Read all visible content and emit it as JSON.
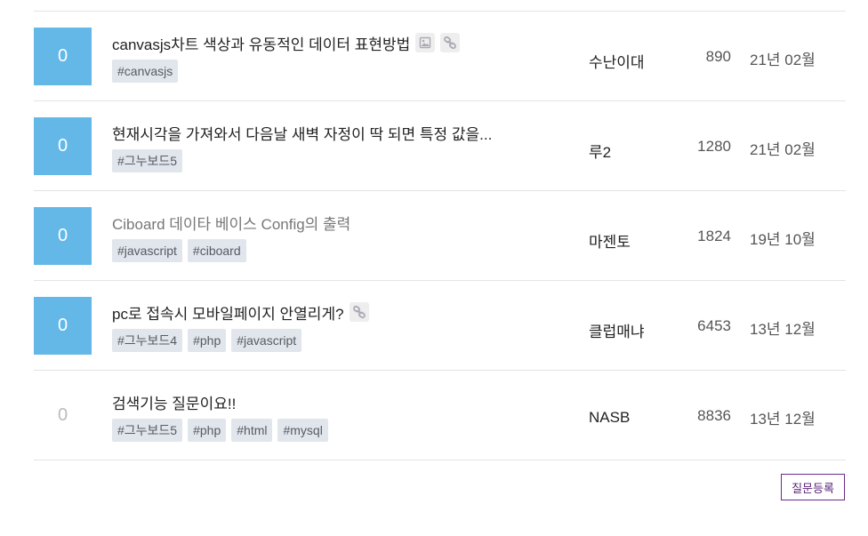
{
  "posts": [
    {
      "answers": "0",
      "answered": true,
      "title": "canvasjs차트 색상과 유동적인 데이터 표현방법",
      "visited": false,
      "icons": [
        "image-icon",
        "link-icon"
      ],
      "tags": [
        "#canvasjs"
      ],
      "author": "수난이대",
      "views": "890",
      "date": "21년 02월"
    },
    {
      "answers": "0",
      "answered": true,
      "title": "현재시각을 가져와서 다음날 새벽 자정이 딱 되면 특정 값을...",
      "visited": false,
      "icons": [],
      "tags": [
        "#그누보드5"
      ],
      "author": "루2",
      "views": "1280",
      "date": "21년 02월"
    },
    {
      "answers": "0",
      "answered": true,
      "title": "Ciboard 데이타 베이스 Config의 출력",
      "visited": true,
      "icons": [],
      "tags": [
        "#javascript",
        "#ciboard"
      ],
      "author": "마젠토",
      "views": "1824",
      "date": "19년 10월"
    },
    {
      "answers": "0",
      "answered": true,
      "title": "pc로 접속시 모바일페이지 안열리게?",
      "visited": false,
      "icons": [
        "link-icon"
      ],
      "tags": [
        "#그누보드4",
        "#php",
        "#javascript"
      ],
      "author": "클럽매냐",
      "views": "6453",
      "date": "13년 12월"
    },
    {
      "answers": "0",
      "answered": false,
      "title": "검색기능 질문이요!!",
      "visited": false,
      "icons": [],
      "tags": [
        "#그누보드5",
        "#php",
        "#html",
        "#mysql"
      ],
      "author": "NASB",
      "views": "8836",
      "date": "13년 12월"
    }
  ],
  "ask_button": "질문등록",
  "colors": {
    "answer_box": "#63b8e8",
    "tag_bg": "#e1e6ec",
    "button_border": "#6a2a88"
  }
}
